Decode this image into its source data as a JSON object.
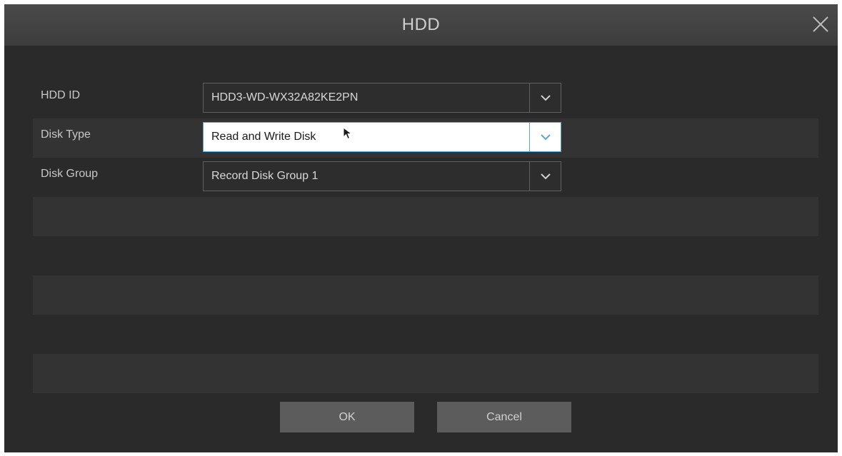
{
  "dialog": {
    "title": "HDD"
  },
  "fields": [
    {
      "label": "HDD ID",
      "value": "HDD3-WD-WX32A82KE2PN",
      "active": false
    },
    {
      "label": "Disk Type",
      "value": "Read and Write Disk",
      "active": true
    },
    {
      "label": "Disk Group",
      "value": "Record Disk Group 1",
      "active": false
    }
  ],
  "buttons": {
    "ok_label": "OK",
    "cancel_label": "Cancel"
  },
  "icons": {
    "close": "close-icon",
    "dropdown": "chevron-down-icon",
    "cursor": "mouse-pointer-icon"
  },
  "colors": {
    "accent": "#5aa6da",
    "dialog_bg": "#2a2a2a",
    "row_alt": "#333333",
    "button_bg": "#5c5c5c"
  }
}
